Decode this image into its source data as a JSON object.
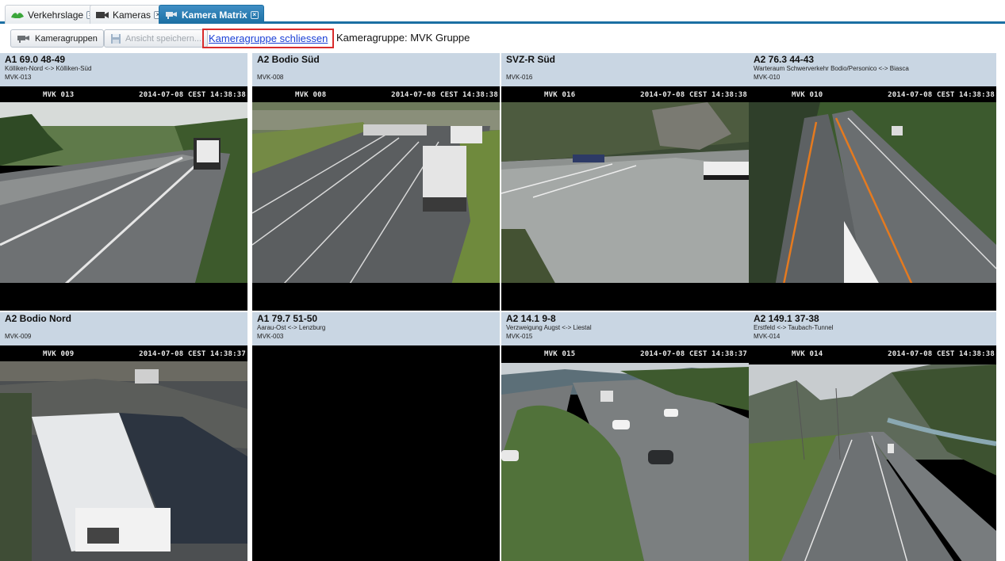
{
  "tabs": [
    {
      "label": "Verkehrslage",
      "icon": "traffic-icon"
    },
    {
      "label": "Kameras",
      "icon": "camera-icon"
    },
    {
      "label": "Kamera Matrix",
      "icon": "camera-matrix-icon"
    }
  ],
  "toolbar": {
    "camera_groups_label": "Kameragruppen",
    "save_view_label": "Ansicht speichern...",
    "close_group_label": "Kameragruppe schliessen",
    "group_label": "Kameragruppe: MVK Gruppe"
  },
  "cameras": [
    {
      "title": "A1 69.0 48-49",
      "subtitle": "Kölliken-Nord <-> Kölliken-Süd",
      "id": "MVK-013",
      "osd_id": "MVK 013",
      "osd_time": "2014-07-08 CEST 14:38:38"
    },
    {
      "title": "A2 Bodio Süd",
      "subtitle": "",
      "id": "MVK-008",
      "osd_id": "MVK 008",
      "osd_time": "2014-07-08 CEST 14:38:38"
    },
    {
      "title": "SVZ-R Süd",
      "subtitle": "",
      "id": "MVK-016",
      "osd_id": "MVK 016",
      "osd_time": "2014-07-08 CEST 14:38:38"
    },
    {
      "title": "A2 76.3 44-43",
      "subtitle": "Warteraum Schwerverkehr Bodio/Personico <-> Biasca",
      "id": "MVK-010",
      "osd_id": "MVK 010",
      "osd_time": "2014-07-08 CEST 14:38:38"
    },
    {
      "title": "A2 Bodio Nord",
      "subtitle": "",
      "id": "MVK-009",
      "osd_id": "MVK 009",
      "osd_time": "2014-07-08 CEST 14:38:37"
    },
    {
      "title": "A1 79.7 51-50",
      "subtitle": "Aarau-Ost <-> Lenzburg",
      "id": "MVK-003",
      "osd_id": "",
      "osd_time": ""
    },
    {
      "title": "A2 14.1 9-8",
      "subtitle": "Verzweigung Augst <-> Liestal",
      "id": "MVK-015",
      "osd_id": "MVK 015",
      "osd_time": "2014-07-08 CEST 14:38:37"
    },
    {
      "title": "A2 149.1 37-38",
      "subtitle": "Erstfeld <-> Taubach-Tunnel",
      "id": "MVK-014",
      "osd_id": "MVK 014",
      "osd_time": "2014-07-08 CEST 14:38:38"
    }
  ]
}
